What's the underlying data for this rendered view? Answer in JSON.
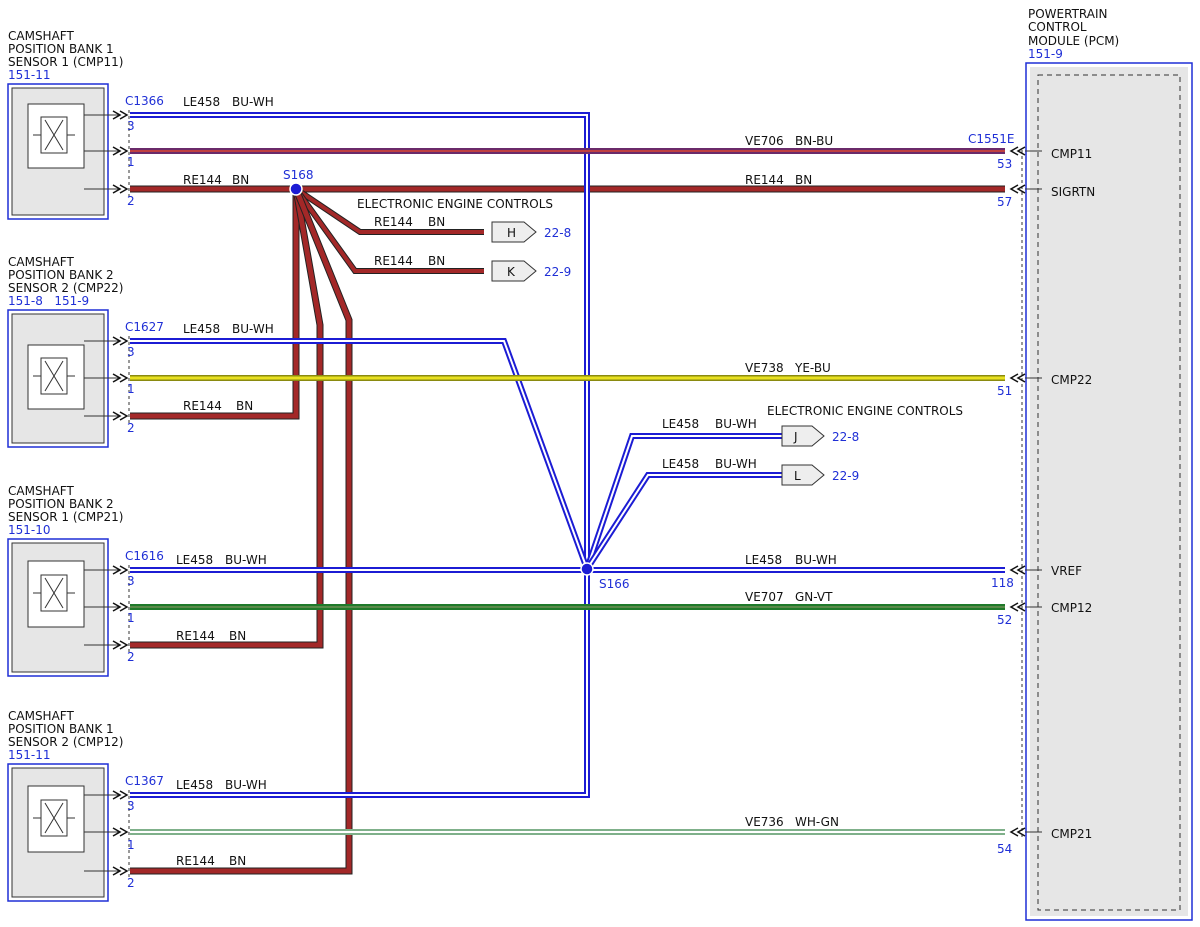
{
  "sensors": [
    {
      "title": [
        "CAMSHAFT",
        "POSITION BANK 1",
        "SENSOR 1 (CMP11)"
      ],
      "ref": "151-11",
      "connector": "C1366",
      "pins": [
        "3",
        "1",
        "2"
      ]
    },
    {
      "title": [
        "CAMSHAFT",
        "POSITION BANK 2",
        "SENSOR 2 (CMP22)"
      ],
      "ref": "151-8   151-9",
      "connector": "C1627",
      "pins": [
        "3",
        "1",
        "2"
      ]
    },
    {
      "title": [
        "CAMSHAFT",
        "POSITION BANK 2",
        "SENSOR 1 (CMP21)"
      ],
      "ref": "151-10",
      "connector": "C1616",
      "pins": [
        "3",
        "1",
        "2"
      ]
    },
    {
      "title": [
        "CAMSHAFT",
        "POSITION BANK 1",
        "SENSOR 2 (CMP12)"
      ],
      "ref": "151-11",
      "connector": "C1367",
      "pins": [
        "3",
        "1",
        "2"
      ]
    }
  ],
  "pcm": {
    "title": [
      "POWERTRAIN",
      "CONTROL",
      "MODULE (PCM)"
    ],
    "ref": "151-9",
    "connector": "C1551E",
    "pins": [
      {
        "num": "53",
        "name": "CMP11"
      },
      {
        "num": "57",
        "name": "SIGRTN"
      },
      {
        "num": "51",
        "name": "CMP22"
      },
      {
        "num": "118",
        "name": "VREF"
      },
      {
        "num": "52",
        "name": "CMP12"
      },
      {
        "num": "54",
        "name": "CMP21"
      }
    ]
  },
  "splices": {
    "s168": "S168",
    "s166": "S166"
  },
  "wires": {
    "le458": "LE458",
    "buwh": "BU-WH",
    "re144": "RE144",
    "bn": "BN",
    "ve706": "VE706",
    "bnbu": "BN-BU",
    "ve738": "VE738",
    "yebu": "YE-BU",
    "ve707": "VE707",
    "gnvt": "GN-VT",
    "ve736": "VE736",
    "whgn": "WH-GN"
  },
  "eec": {
    "title": "ELECTRONIC ENGINE CONTROLS",
    "connectors": [
      {
        "letter": "H",
        "ref": "22-8"
      },
      {
        "letter": "K",
        "ref": "22-9"
      },
      {
        "letter": "J",
        "ref": "22-8"
      },
      {
        "letter": "L",
        "ref": "22-9"
      }
    ]
  },
  "colors": {
    "brown": "#a32828",
    "blue": "#1c1cd4",
    "purple": "#6a2a6a",
    "yellow": "#e8e020",
    "green": "#1f7a2a",
    "whitegreen": "#7fb08a",
    "label_blue": "#1f2fd6"
  }
}
